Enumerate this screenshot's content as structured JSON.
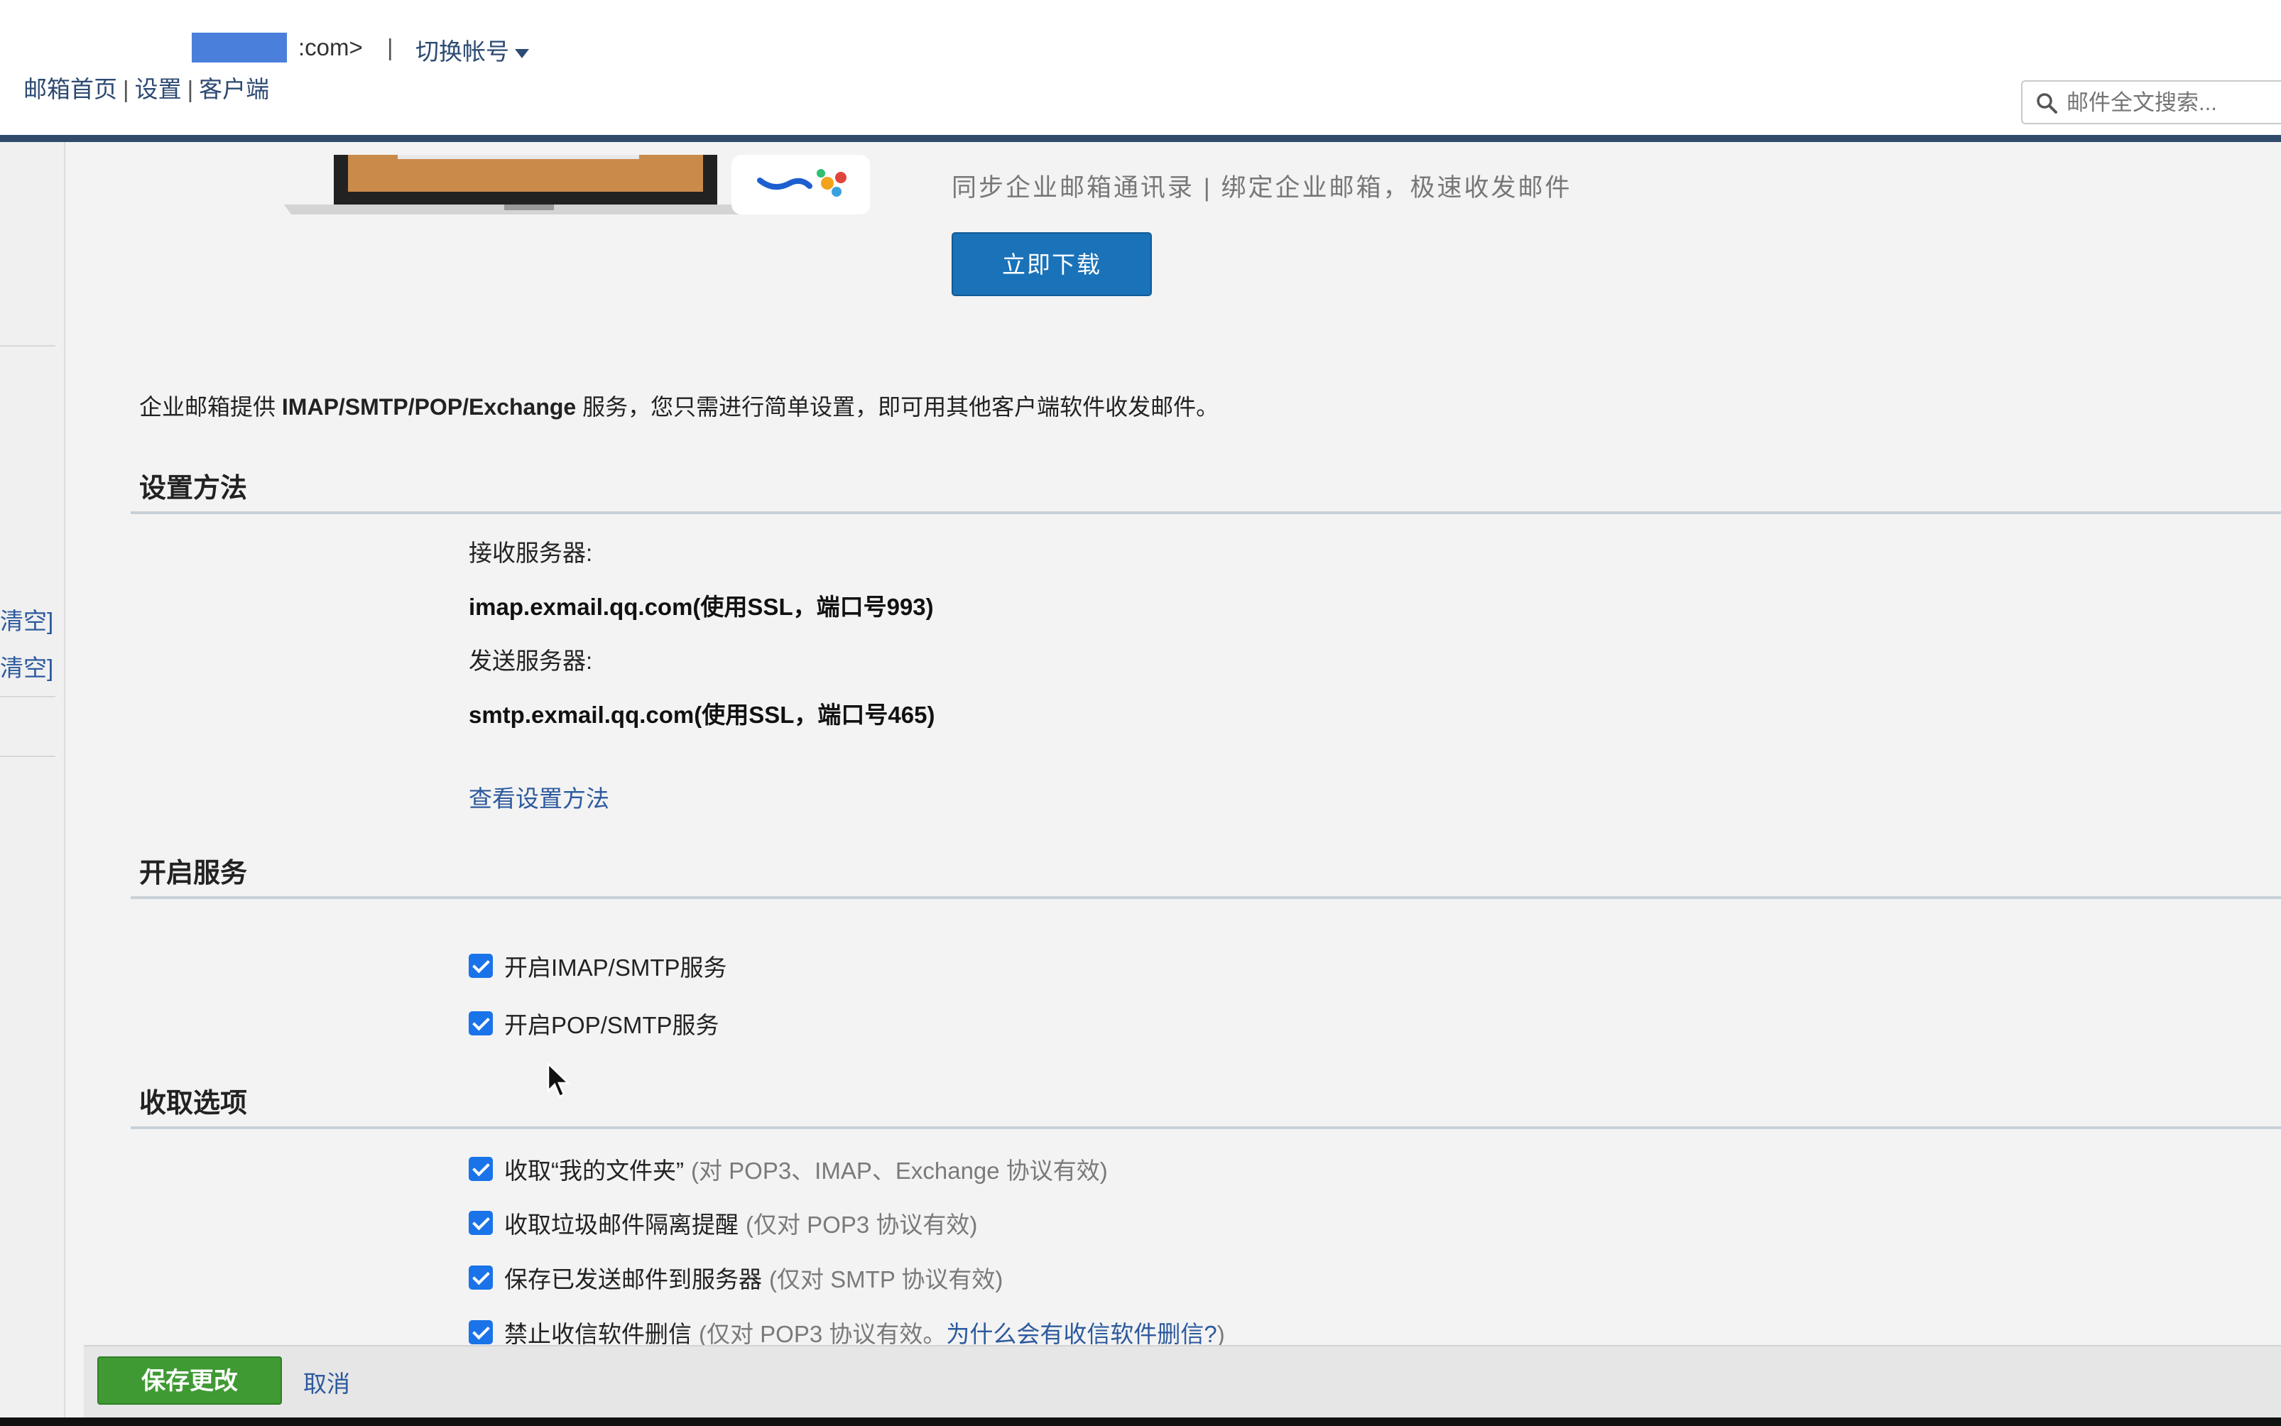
{
  "header": {
    "account_suffix": ":com>",
    "separator": "|",
    "switch_account": "切换帐号",
    "links": [
      "邮箱首页",
      "设置",
      "客户端"
    ],
    "search_placeholder": "邮件全文搜索..."
  },
  "sidebar": {
    "clear_items": [
      "清空]",
      "清空]"
    ]
  },
  "banner": {
    "description": "同步企业邮箱通讯录 | 绑定企业邮箱，极速收发邮件",
    "download_button": "立即下载"
  },
  "intro": {
    "prefix": "企业邮箱提供 ",
    "protocols": "IMAP/SMTP/POP/Exchange",
    "suffix": " 服务，您只需进行简单设置，即可用其他客户端软件收发邮件。"
  },
  "setup": {
    "title": "设置方法",
    "receive_label": "接收服务器:",
    "receive_server": "imap.exmail.qq.com(使用SSL，端口号993)",
    "send_label": "发送服务器:",
    "send_server": "smtp.exmail.qq.com(使用SSL，端口号465)",
    "view_link": "查看设置方法"
  },
  "services": {
    "title": "开启服务",
    "options": [
      {
        "label": "开启IMAP/SMTP服务",
        "checked": true
      },
      {
        "label": "开启POP/SMTP服务",
        "checked": true
      }
    ]
  },
  "fetch": {
    "title": "收取选项",
    "options": [
      {
        "label": "收取“我的文件夹”",
        "hint": "(对 POP3、IMAP、Exchange 协议有效)",
        "checked": true
      },
      {
        "label": "收取垃圾邮件隔离提醒",
        "hint": "(仅对 POP3 协议有效)",
        "checked": true
      },
      {
        "label": "保存已发送邮件到服务器",
        "hint": "(仅对 SMTP 协议有效)",
        "checked": true
      },
      {
        "label": "禁止收信软件删信",
        "hint": "(仅对 POP3 协议有效。",
        "hint_link": "为什么会有收信软件删信?",
        "hint_end": ")",
        "checked": true
      }
    ]
  },
  "footer": {
    "save_button": "保存更改",
    "cancel_button": "取消"
  },
  "colors": {
    "link": "#2d5a9e",
    "primary_button": "#1a72b8",
    "save_button": "#3f9a33",
    "checkbox": "#1a73e8"
  }
}
